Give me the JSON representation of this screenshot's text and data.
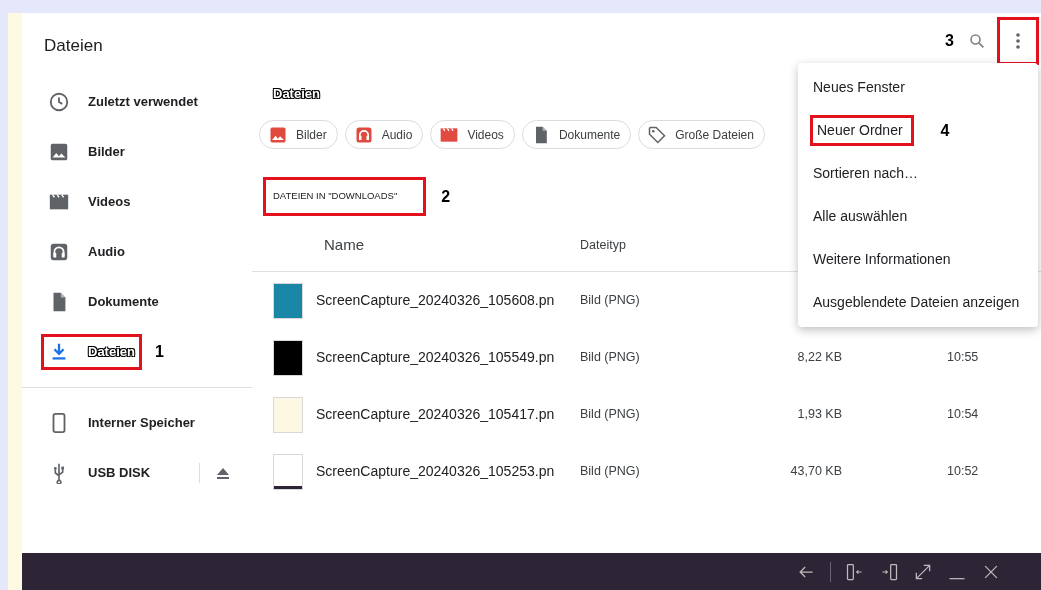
{
  "window": {
    "title": "Dateien"
  },
  "sidebar": {
    "items": [
      {
        "label": "Zuletzt verwendet",
        "kind": "clock",
        "selected": false
      },
      {
        "label": "Bilder",
        "kind": "image",
        "selected": false
      },
      {
        "label": "Videos",
        "kind": "film",
        "selected": false
      },
      {
        "label": "Audio",
        "kind": "headphones",
        "selected": false
      },
      {
        "label": "Dokumente",
        "kind": "document",
        "selected": false
      },
      {
        "label": "Dateien",
        "kind": "download",
        "selected": true,
        "callout": "1"
      }
    ],
    "devices": [
      {
        "label": "Interner Speicher",
        "kind": "phone",
        "ejectable": false
      },
      {
        "label": "USB DISK",
        "kind": "usb",
        "ejectable": true
      }
    ]
  },
  "toolbar": {
    "callout": "3"
  },
  "breadcrumb": "Dateien",
  "chips": [
    {
      "label": "Bilder",
      "kind": "image"
    },
    {
      "label": "Audio",
      "kind": "headphones"
    },
    {
      "label": "Videos",
      "kind": "film"
    },
    {
      "label": "Dokumente",
      "kind": "document"
    },
    {
      "label": "Große Dateien",
      "kind": "tag"
    }
  ],
  "section": {
    "label": "DATEIEN IN \"DOWNLOADS\"",
    "callout": "2"
  },
  "table": {
    "columns": [
      "Name",
      "Dateityp"
    ],
    "rows": [
      {
        "name": "ScreenCapture_20240326_105608.pn",
        "type": "Bild (PNG)",
        "color": "#1a86a6"
      },
      {
        "name": "ScreenCapture_20240326_105549.pn",
        "type": "Bild (PNG)",
        "size": "8,22 KB",
        "time": "10:55",
        "color": "#000000"
      },
      {
        "name": "ScreenCapture_20240326_105417.pn",
        "type": "Bild (PNG)",
        "size": "1,93 KB",
        "time": "10:54",
        "color": "#fdf8e3"
      },
      {
        "name": "ScreenCapture_20240326_105253.pn",
        "type": "Bild (PNG)",
        "size": "43,70 KB",
        "time": "10:52",
        "color": "#ffffff"
      }
    ]
  },
  "menu": {
    "items": [
      {
        "label": "Neues Fenster"
      },
      {
        "label": "Neuer Ordner",
        "callout": "4"
      },
      {
        "label": "Sortieren nach…"
      },
      {
        "label": "Alle auswählen"
      },
      {
        "label": "Weitere Informationen"
      },
      {
        "label": "Ausgeblendete Dateien anzeigen"
      }
    ]
  }
}
